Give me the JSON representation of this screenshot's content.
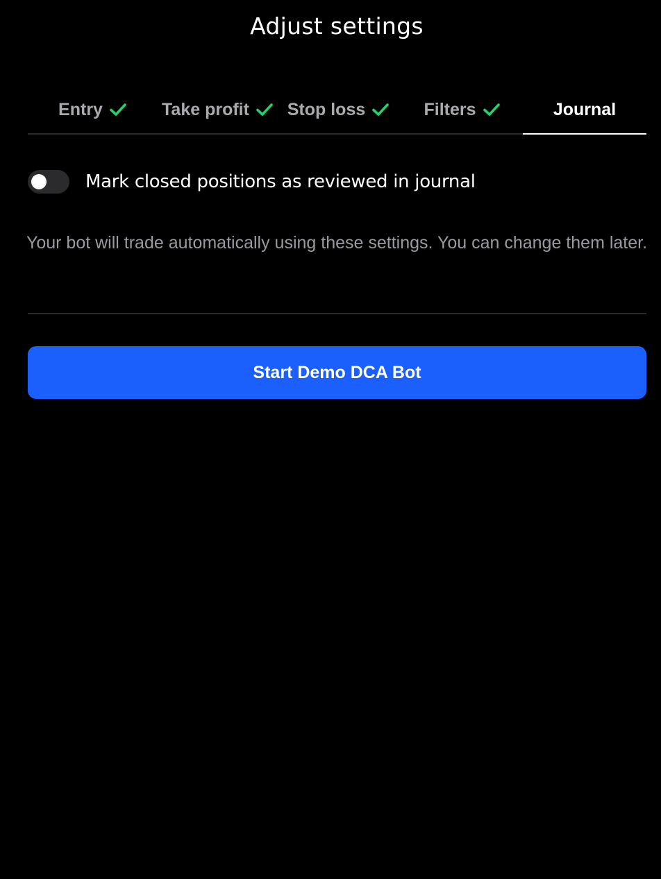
{
  "header": {
    "title": "Adjust settings"
  },
  "tabs": [
    {
      "label": "Entry",
      "completed": true,
      "active": false
    },
    {
      "label": "Take profit",
      "completed": true,
      "active": false
    },
    {
      "label": "Stop loss",
      "completed": true,
      "active": false
    },
    {
      "label": "Filters",
      "completed": true,
      "active": false
    },
    {
      "label": "Journal",
      "completed": false,
      "active": true
    }
  ],
  "journal": {
    "toggle_label": "Mark closed positions as reviewed in journal",
    "toggle_on": false
  },
  "info": {
    "text": "Your bot will trade automatically using these settings. You can change them later."
  },
  "actions": {
    "start_button_label": "Start Demo DCA Bot"
  },
  "colors": {
    "background": "#000000",
    "check": "#22d36b",
    "primary_button": "#1b5ffc",
    "muted_text": "#9a9aa0",
    "divider": "#2a2a2c"
  },
  "icons": {
    "tab_completed": "check-icon"
  }
}
